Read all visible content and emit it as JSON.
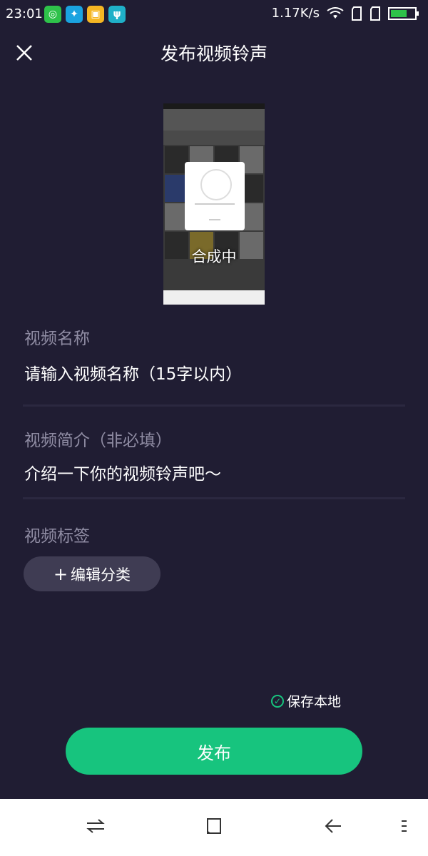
{
  "status_bar": {
    "time": "23:01",
    "network_speed": "1.17K/s",
    "app_icons": [
      "message-app-icon",
      "browser-app-icon",
      "gallery-app-icon",
      "usb-icon"
    ],
    "system_icons": [
      "wifi-icon",
      "sim-card-icon",
      "sim-card-icon",
      "battery-icon"
    ]
  },
  "header": {
    "title": "发布视频铃声",
    "close_icon": "close-icon"
  },
  "preview": {
    "overlay_text": "合成中"
  },
  "form": {
    "name_label": "视频名称",
    "name_placeholder": "请输入视频名称（15字以内）",
    "desc_label": "视频简介（非必填）",
    "desc_placeholder": "介绍一下你的视频铃声吧～",
    "tag_label": "视频标签",
    "tag_button": "编辑分类"
  },
  "save_local": {
    "label": "保存本地",
    "checked": true,
    "color": "#17c47e"
  },
  "publish_button": {
    "label": "发布",
    "color": "#17c47e"
  },
  "nav_bar": {
    "icons": [
      "switch-icon",
      "home-icon",
      "back-icon",
      "menu-icon"
    ]
  },
  "colors": {
    "background": "#201d33",
    "accent": "#17c47e",
    "label": "#8f8ca3"
  }
}
